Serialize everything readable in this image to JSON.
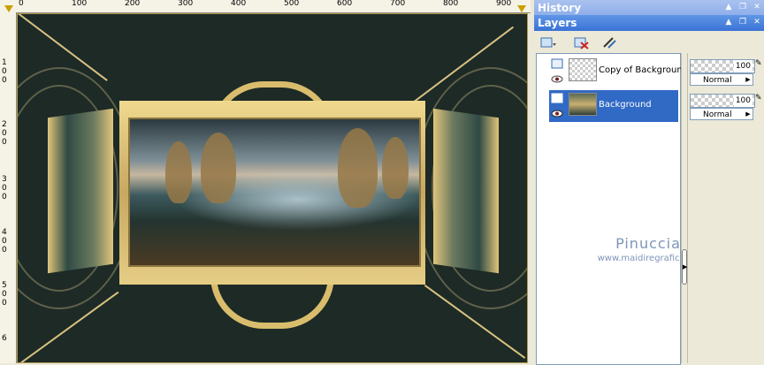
{
  "ruler_top": {
    "labels": [
      "0",
      "100",
      "200",
      "300",
      "400",
      "500",
      "600",
      "700",
      "800",
      "900"
    ]
  },
  "ruler_left": {
    "labels": [
      "1\n0\n0",
      "2\n0\n0",
      "3\n0\n0",
      "4\n0\n0",
      "5\n0\n0",
      "6"
    ]
  },
  "history_panel": {
    "title": "History"
  },
  "layers_panel": {
    "title": "Layers",
    "layers": [
      {
        "name": "Copy of Background",
        "opacity": "100",
        "blend_mode": "Normal",
        "selected": false
      },
      {
        "name": "Background",
        "opacity": "100",
        "blend_mode": "Normal",
        "selected": true
      }
    ]
  },
  "watermark": {
    "name": "Pinuccia",
    "url": "www.maidiregrafica.eu"
  },
  "colors": {
    "title_bar": "#3a73d6",
    "selection": "#316ac5",
    "frame_gold": "#d9bd6c",
    "panel_bg": "#ece9d8"
  },
  "icons": [
    "pin-icon",
    "restore-icon",
    "close-icon",
    "new-layer-icon",
    "delete-layer-icon",
    "edit-layer-icon",
    "eye-icon",
    "lock-icon"
  ]
}
